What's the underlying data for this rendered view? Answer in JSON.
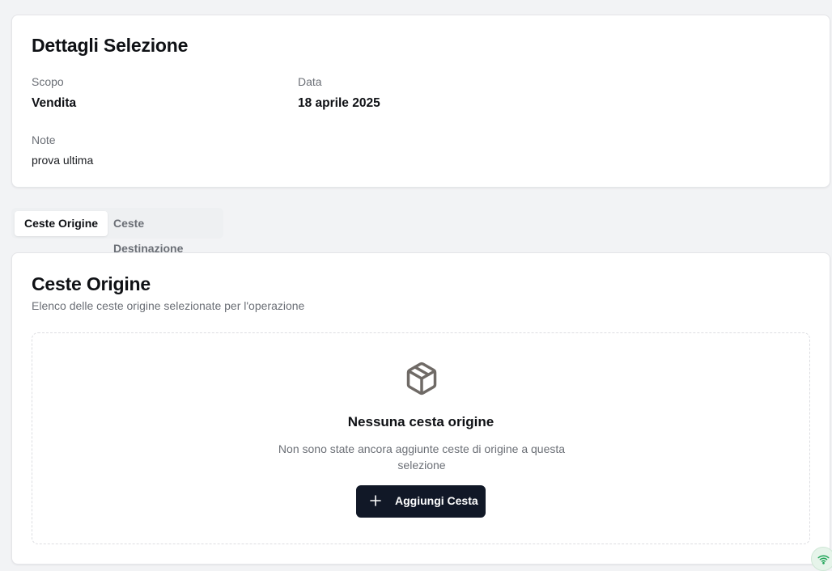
{
  "details": {
    "title": "Dettagli Selezione",
    "scope_label": "Scopo",
    "scope_value": "Vendita",
    "date_label": "Data",
    "date_value": "18 aprile 2025",
    "notes_label": "Note",
    "notes_value": "prova ultima"
  },
  "tabs": [
    {
      "label": "Ceste Origine",
      "active": true
    },
    {
      "label": "Ceste Destinazione",
      "active": false
    }
  ],
  "origin": {
    "title": "Ceste Origine",
    "subtitle": "Elenco delle ceste origine selezionate per l'operazione",
    "empty_icon": "package-icon",
    "empty_title": "Nessuna cesta origine",
    "empty_description": "Non sono state ancora aggiunte ceste di origine a questa selezione",
    "add_button_label": "Aggiungi Cesta",
    "add_button_icon": "plus-icon"
  },
  "status": {
    "icon": "wifi-icon",
    "color": "#22a55a"
  },
  "colors": {
    "primary_button": "#111827",
    "muted_text": "#6b6f76",
    "background": "#f2f3f5"
  }
}
